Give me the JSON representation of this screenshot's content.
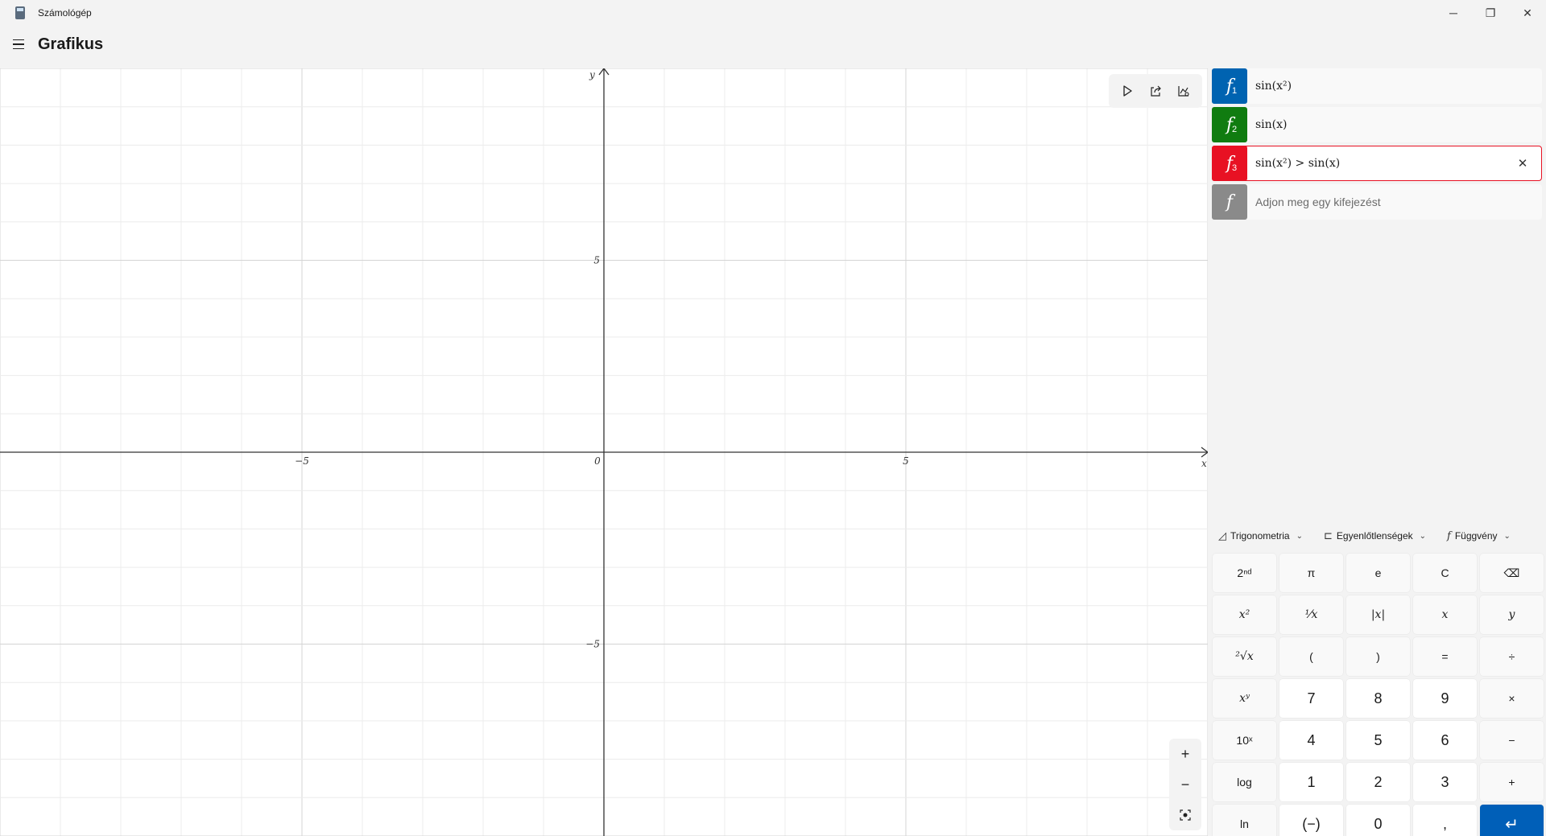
{
  "window": {
    "title": "Számológép",
    "minimize_glyph": "─",
    "maximize_glyph": "❐",
    "close_glyph": "✕"
  },
  "header": {
    "title": "Grafikus"
  },
  "graph": {
    "axis_x_label": "x",
    "axis_y_label": "y",
    "x_tick_labels": [
      "−5",
      "0",
      "5"
    ],
    "y_tick_labels": [
      "5",
      "−5"
    ],
    "x_range": [
      -10,
      10
    ],
    "y_range": [
      -10,
      10
    ],
    "grid": true,
    "toolbar_icons": [
      "trace-cursor-icon",
      "share-icon",
      "graph-options-icon"
    ],
    "zoom_in_glyph": "+",
    "zoom_out_glyph": "−",
    "fit_icon": "fit-view-icon"
  },
  "functions": [
    {
      "name": "f",
      "index": "1",
      "expression": "sin(x²)",
      "color": "#0063b1"
    },
    {
      "name": "f",
      "index": "2",
      "expression": "sin(x)",
      "color": "#107c10"
    },
    {
      "name": "f",
      "index": "3",
      "expression": "sin(x²) > sin(x)",
      "color": "#e81123",
      "clear_glyph": "✕"
    },
    {
      "name": "f",
      "index": "",
      "placeholder": "Adjon meg egy kifejezést",
      "color": "#8a8a8a"
    }
  ],
  "categories": [
    {
      "icon": "◿",
      "label": "Trigonometria"
    },
    {
      "icon": "⊏",
      "label": "Egyenlőtlenségek"
    },
    {
      "icon": "f",
      "label": "Függvény"
    }
  ],
  "keypad": {
    "keys": [
      "2ⁿᵈ",
      "π",
      "e",
      "C",
      "⌫",
      "x²",
      "¹⁄x",
      "|x|",
      "x",
      "y",
      "²√x",
      "(",
      ")",
      "=",
      "÷",
      "xʸ",
      "7",
      "8",
      "9",
      "×",
      "10ˣ",
      "4",
      "5",
      "6",
      "−",
      "log",
      "1",
      "2",
      "3",
      "+",
      "ln",
      "(−)",
      "0",
      ",",
      "↵"
    ]
  }
}
